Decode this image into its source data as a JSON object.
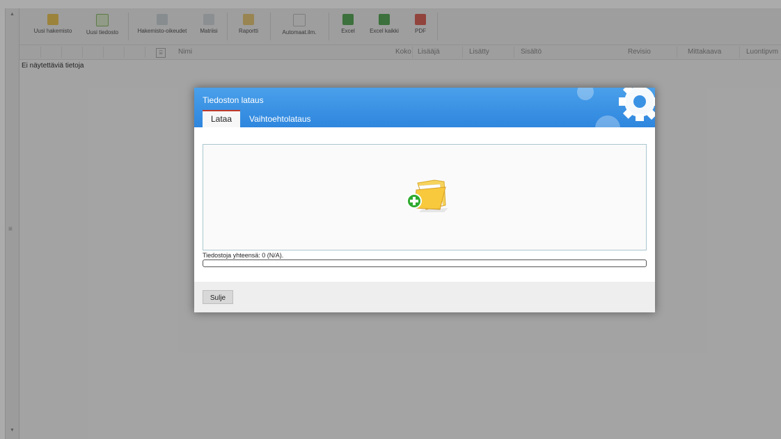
{
  "toolbar": {
    "new_folder": "Uusi hakemisto",
    "new_file": "Uusi tiedosto",
    "folder_rights": "Hakemisto-oikeudet",
    "matrix": "Matriisi",
    "report": "Raportti",
    "auto_notify": "Automaat.ilm.",
    "excel": "Excel",
    "excel_all": "Excel kaikki",
    "pdf": "PDF"
  },
  "grid": {
    "columns": [
      "Nimi",
      "Koko",
      "Lisääjä",
      "Lisätty",
      "Sisältö",
      "Revisio",
      "Mittakaava",
      "Luontipvm"
    ],
    "empty_message": "Ei näytettäviä tietoja"
  },
  "dialog": {
    "title": "Tiedoston lataus",
    "tabs": [
      "Lataa",
      "Vaihtoehtolataus"
    ],
    "file_count_label": "Tiedostoja yhteensä: 0 (N/A).",
    "progress": 0,
    "close_label": "Sulje"
  },
  "icons": {
    "new_folder": "folder-add-icon",
    "new_file": "file-add-icon",
    "folder_rights": "rights-icon",
    "matrix": "matrix-icon",
    "report": "report-icon",
    "auto_notify": "notify-icon",
    "excel": "excel-icon",
    "excel_all": "excel-all-icon",
    "pdf": "pdf-icon",
    "drop_folder": "folder-add-icon"
  },
  "colors": {
    "header_blue": "#2e86de",
    "active_tab_border": "#c0392b",
    "add_green": "#2eab2e"
  }
}
